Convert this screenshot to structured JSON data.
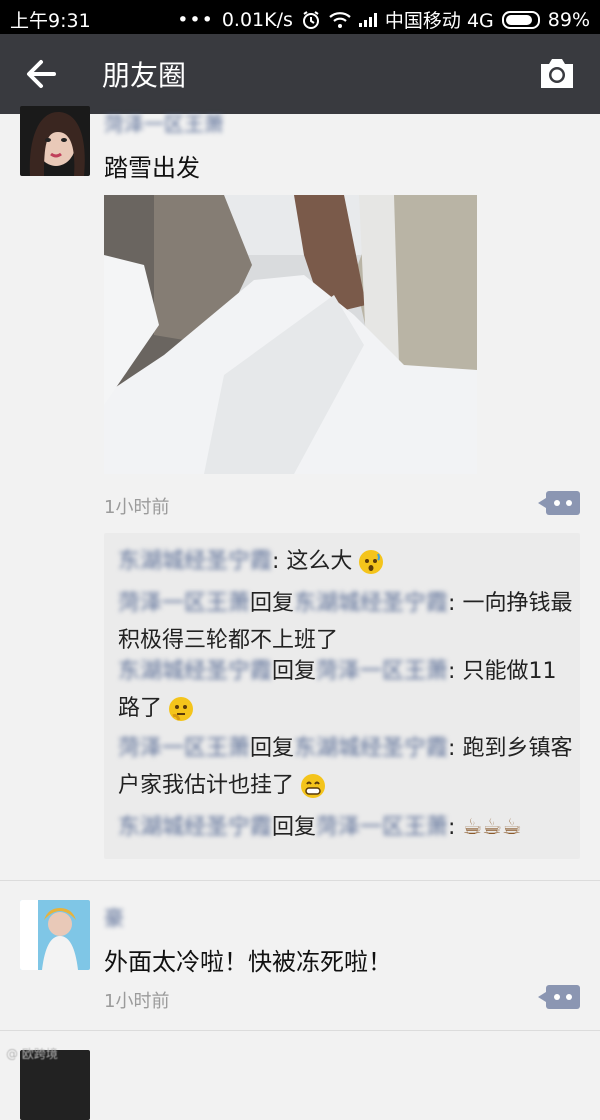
{
  "status_bar": {
    "time": "上午9:31",
    "dots": "•••",
    "speed": "0.01K/s",
    "carrier": "中国移动 4G",
    "battery": "89%"
  },
  "nav": {
    "title": "朋友圈"
  },
  "post1": {
    "text": "踏雪出发",
    "time": "1小时前",
    "author": "菏泽一区王萧",
    "comments": [
      {
        "name": "东湖城经圣宁霞",
        "sep": ": ",
        "text": "这么大"
      },
      {
        "name": "菏泽一区王萧",
        "reply": "回复",
        "target": "东湖城经圣宁霞",
        "sep": ": ",
        "text": "一向挣钱最积极得三轮都不上班了"
      },
      {
        "name": "东湖城经圣宁霞",
        "reply": "回复",
        "target": "菏泽一区王萧",
        "sep": ": ",
        "text": "只能做11路了"
      },
      {
        "name": "菏泽一区王萧",
        "reply": "回复",
        "target": "东湖城经圣宁霞",
        "sep": ": ",
        "text": "跑到乡镇客户家我估计也挂了"
      },
      {
        "name": "东湖城经圣宁霞",
        "reply": "回复",
        "target": "菏泽一区王萧",
        "sep": ": ",
        "text": "☕☕☕"
      }
    ]
  },
  "post2": {
    "author": "豪",
    "text": "外面太冷啦！快被冻死啦！",
    "time": "1小时前"
  },
  "watermark": "@ 欧跨境"
}
